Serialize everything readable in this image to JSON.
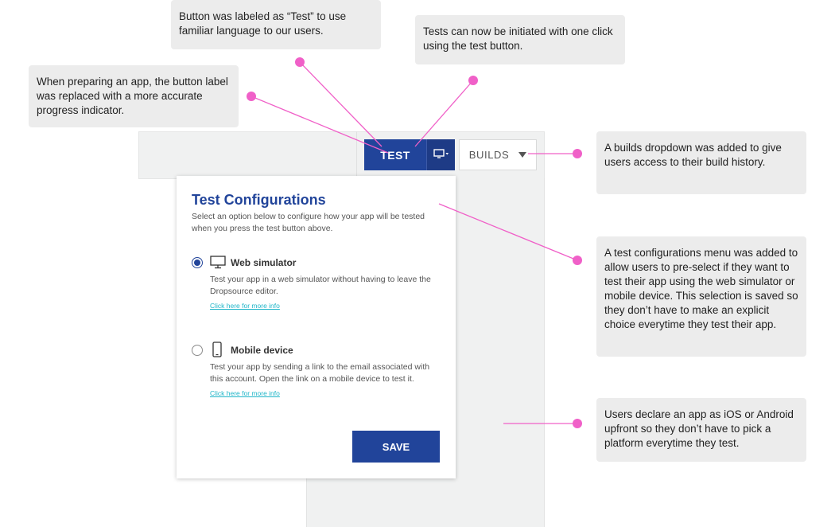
{
  "toolbar": {
    "test_label": "TEST",
    "builds_label": "BUILDS"
  },
  "test_config": {
    "title": "Test Configurations",
    "description": "Select an option below to configure how your app will be tested when you press the test button above.",
    "options": [
      {
        "label": "Web simulator",
        "description": "Test your app in a web simulator without having to leave the Dropsource editor.",
        "link": "Click here for more info",
        "selected": true,
        "icon": "monitor-icon"
      },
      {
        "label": "Mobile device",
        "description": "Test your app by sending a link to the email associated with this account. Open the link on a mobile device to test it.",
        "link": "Click here for more info",
        "selected": false,
        "icon": "phone-icon"
      }
    ],
    "save_label": "SAVE"
  },
  "annotations": {
    "button_label": "Button was labeled as “Test” to use familiar language to our users.",
    "one_click": "Tests can now be initiated with one click using the test button.",
    "progress": "When preparing an app, the button label was replaced with a more accurate progress indicator.",
    "builds": "A builds dropdown was added to give users access to their build history.",
    "test_menu": "A test configurations menu was added to allow users to pre-select if they want to test their app using the web simulator or mobile device. This selection is saved so they don’t have to make an explicit choice everytime they test their app.",
    "platform": "Users declare an app as iOS or Android upfront so they don’t have to pick a platform everytime they test."
  },
  "colors": {
    "primary": "#21449a",
    "link": "#1fb5c8",
    "annotation_line": "#f060c8",
    "callout_bg": "#ececec"
  }
}
